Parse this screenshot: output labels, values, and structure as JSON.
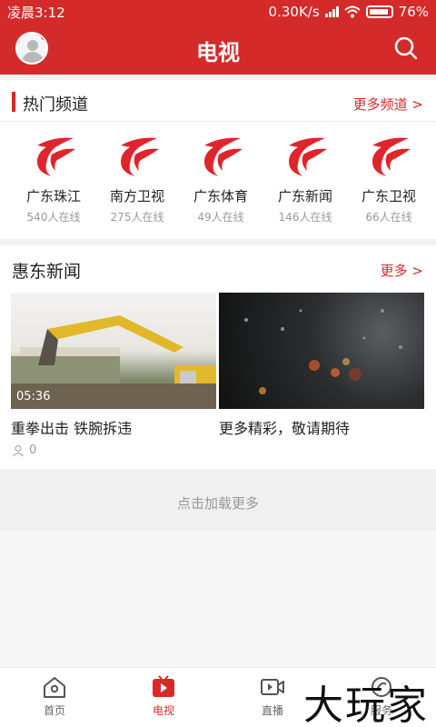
{
  "status": {
    "time": "凌晨3:12",
    "speed": "0.30K/s",
    "battery": "76%"
  },
  "header": {
    "title": "电视"
  },
  "hot_channels": {
    "title": "热门频道",
    "more": "更多频道 >",
    "items": [
      {
        "name": "广东珠江",
        "online": "540人在线"
      },
      {
        "name": "南方卫视",
        "online": "275人在线"
      },
      {
        "name": "广东体育",
        "online": "49人在线"
      },
      {
        "name": "广东新闻",
        "online": "146人在线"
      },
      {
        "name": "广东卫视",
        "online": "66人在线"
      }
    ]
  },
  "news": {
    "title": "惠东新闻",
    "more": "更多 >",
    "videos": [
      {
        "title": "重拳出击 铁腕拆违",
        "duration": "05:36",
        "views": "0"
      },
      {
        "title": "更多精彩，敬请期待"
      }
    ]
  },
  "load_more": "点击加载更多",
  "tabs": [
    {
      "label": "首页"
    },
    {
      "label": "电视"
    },
    {
      "label": "直播"
    },
    {
      "label": "服务"
    }
  ],
  "watermark": "大玩家",
  "colors": {
    "brand": "#d42a2a"
  }
}
